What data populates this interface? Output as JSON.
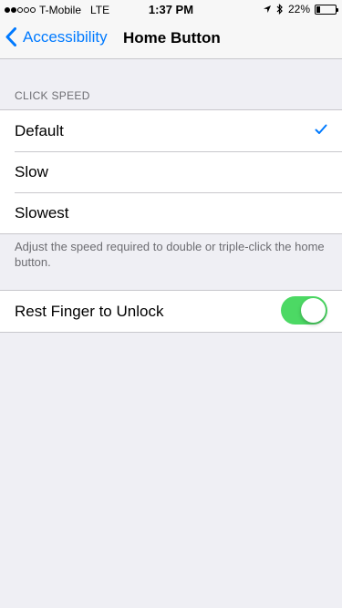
{
  "status_bar": {
    "carrier": "T-Mobile",
    "network": "LTE",
    "time": "1:37 PM",
    "battery_percent": "22%",
    "battery_level": 0.22,
    "signal_bars": 2,
    "icons": [
      "location-arrow-icon",
      "bluetooth-icon",
      "battery-icon"
    ]
  },
  "nav": {
    "back_label": "Accessibility",
    "title": "Home Button"
  },
  "click_speed": {
    "header": "CLICK SPEED",
    "options": [
      {
        "label": "Default",
        "selected": true
      },
      {
        "label": "Slow",
        "selected": false
      },
      {
        "label": "Slowest",
        "selected": false
      }
    ],
    "footer": "Adjust the speed required to double or triple-click the home button."
  },
  "rest_finger": {
    "label": "Rest Finger to Unlock",
    "enabled": true
  },
  "colors": {
    "accent": "#007aff",
    "toggle_on": "#4cd964",
    "background": "#efeff4"
  }
}
